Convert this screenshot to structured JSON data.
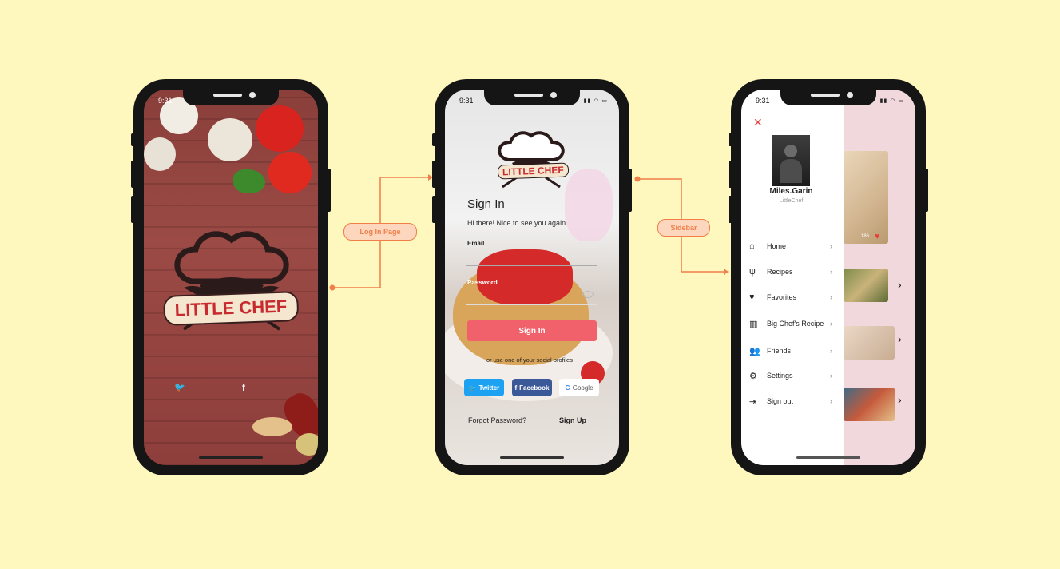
{
  "splash": {
    "status_time": "9:31",
    "logo_text": "LITTLE CHEF",
    "twitter_glyph": "🐦",
    "facebook_glyph": "f"
  },
  "login": {
    "status_time": "9:31",
    "logo_text": "LITTLE CHEF",
    "title": "Sign In",
    "subtitle": "Hi there! Nice to see you again.",
    "email_label": "Email",
    "password_label": "Password",
    "signin_button": "Sign In",
    "social_text": "or use one of your social profiles",
    "twitter_label": "Twitter",
    "facebook_label": "Facebook",
    "google_label": "Google",
    "forgot_password": "Forgot Password?",
    "signup": "Sign Up"
  },
  "sidebar": {
    "status_time": "9:31",
    "close_glyph": "✕",
    "user_name": "Miles.Garin",
    "user_handle": "LittleChef",
    "likes": "186",
    "items": [
      {
        "label": "Home",
        "icon": "home-icon"
      },
      {
        "label": "Recipes",
        "icon": "fork-knife-icon"
      },
      {
        "label": "Favorites",
        "icon": "heart-icon"
      },
      {
        "label": "Big Chef's Recipe",
        "icon": "book-icon"
      },
      {
        "label": "Friends",
        "icon": "friends-icon"
      },
      {
        "label": "Settings",
        "icon": "gear-icon"
      },
      {
        "label": "Sign out",
        "icon": "sign-out-icon"
      }
    ]
  },
  "connectors": {
    "login_page": "Log In Page",
    "sidebar": "Sidebar"
  },
  "colors": {
    "background": "#fef7be",
    "accent": "#f1616b",
    "connector": "#f07f4a",
    "twitter": "#1da1f2",
    "facebook": "#3b5998"
  }
}
